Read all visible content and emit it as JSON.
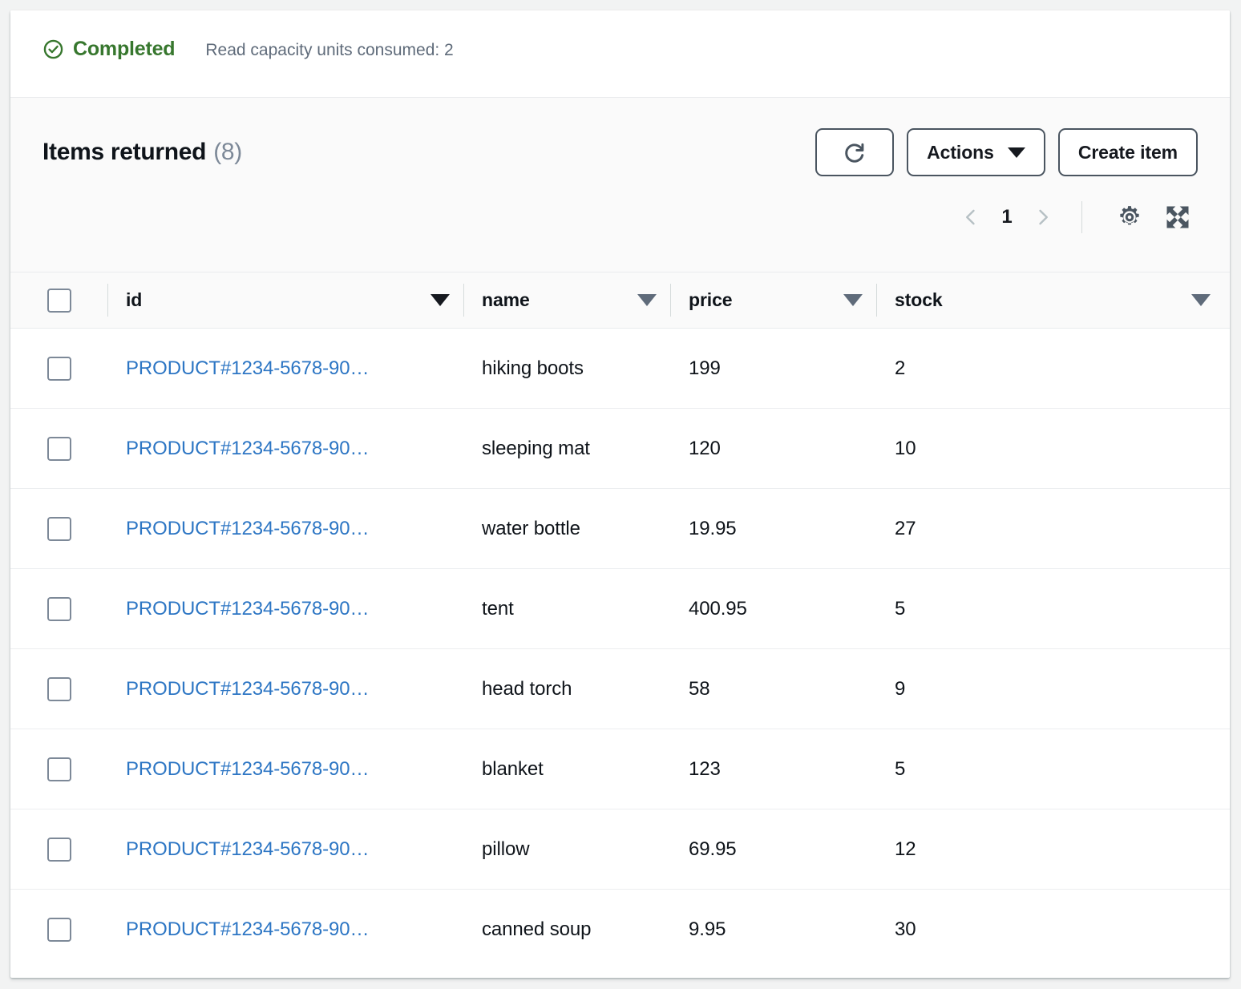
{
  "status": {
    "icon": "check-circle-icon",
    "label": "Completed",
    "note": "Read capacity units consumed: 2",
    "color": "#37772e"
  },
  "header": {
    "title": "Items returned",
    "count": "(8)",
    "refresh_icon": "refresh-icon",
    "actions_label": "Actions",
    "create_label": "Create item"
  },
  "pagination": {
    "prev_icon": "chevron-left-icon",
    "page": "1",
    "next_icon": "chevron-right-icon",
    "settings_icon": "gear-icon",
    "expand_icon": "expand-icon"
  },
  "table": {
    "columns": [
      {
        "label": "id",
        "sort_active": true
      },
      {
        "label": "name",
        "sort_active": false
      },
      {
        "label": "price",
        "sort_active": false
      },
      {
        "label": "stock",
        "sort_active": false
      }
    ],
    "rows": [
      {
        "id": "PRODUCT#1234-5678-90…",
        "name": "hiking boots",
        "price": "199",
        "stock": "2"
      },
      {
        "id": "PRODUCT#1234-5678-90…",
        "name": "sleeping mat",
        "price": "120",
        "stock": "10"
      },
      {
        "id": "PRODUCT#1234-5678-90…",
        "name": "water bottle",
        "price": "19.95",
        "stock": "27"
      },
      {
        "id": "PRODUCT#1234-5678-90…",
        "name": "tent",
        "price": "400.95",
        "stock": "5"
      },
      {
        "id": "PRODUCT#1234-5678-90…",
        "name": "head torch",
        "price": "58",
        "stock": "9"
      },
      {
        "id": "PRODUCT#1234-5678-90…",
        "name": "blanket",
        "price": "123",
        "stock": "5"
      },
      {
        "id": "PRODUCT#1234-5678-90…",
        "name": "pillow",
        "price": "69.95",
        "stock": "12"
      },
      {
        "id": "PRODUCT#1234-5678-90…",
        "name": "canned soup",
        "price": "9.95",
        "stock": "30"
      }
    ]
  },
  "colors": {
    "link": "#2d76c4",
    "success": "#37772e",
    "text": "#0f141a",
    "muted": "#5f6b7a",
    "border": "#d5dbdb",
    "page_bg": "#f2f3f3"
  }
}
